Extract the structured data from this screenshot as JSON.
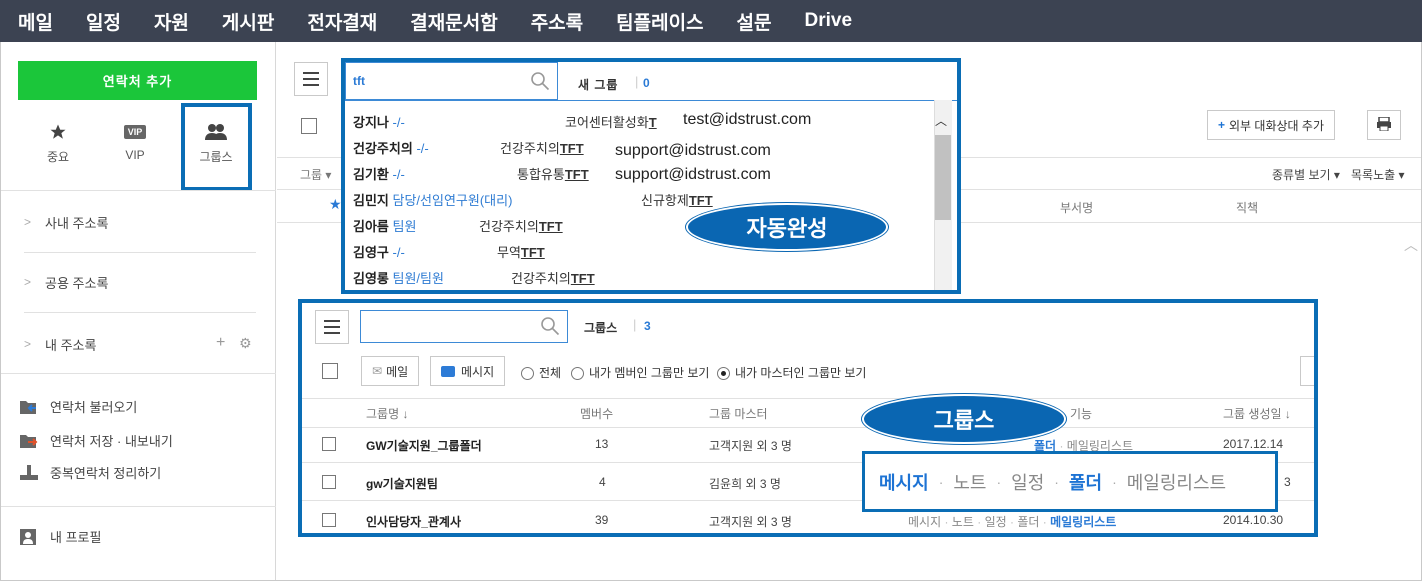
{
  "topnav": {
    "items": [
      "메일",
      "일정",
      "자원",
      "게시판",
      "전자결재",
      "결재문서함",
      "주소록",
      "팀플레이스",
      "설문",
      "Drive"
    ]
  },
  "sidebar": {
    "add_contact": "연락처 추가",
    "quick": [
      {
        "label": "중요",
        "icon": "star-icon"
      },
      {
        "label": "VIP",
        "badge": "VIP",
        "icon": "vip-icon"
      },
      {
        "label": "그룹스",
        "icon": "group-icon"
      }
    ],
    "sections": [
      "사내 주소록",
      "공용 주소록",
      "내 주소록"
    ],
    "tools": [
      "연락처 불러오기",
      "연락처 저장 · 내보내기",
      "중복연락처 정리하기"
    ],
    "profile": "내 프로필"
  },
  "main": {
    "add_external": "외부 대화상대 추가",
    "group_dropdown": "그룹",
    "view_by_type": "종류별 보기",
    "list_exposure": "목록노출",
    "col_dept": "부서명",
    "col_position": "직책"
  },
  "autocomplete": {
    "query": "tft",
    "new_group_label": "새 그룹",
    "new_group_count": "0",
    "callout": "자동완성",
    "rows": [
      {
        "name": "강지나",
        "pos": "-/-",
        "dept_pre": "코어센터활성화",
        "dept_u": "T",
        "email": "test@idstrust.com"
      },
      {
        "name": "건강주치의",
        "pos": "-/-",
        "dept_pre": "건강주치의",
        "dept_u": "TFT",
        "email": "support@idstrust.com"
      },
      {
        "name": "김기환",
        "pos": "-/-",
        "dept_pre": "통합유통",
        "dept_u": "TFT",
        "email": "support@idstrust.com"
      },
      {
        "name": "김민지",
        "pos": "담당/선임연구원(대리)",
        "dept_pre": "신규항제",
        "dept_u": "TFT",
        "email": ""
      },
      {
        "name": "김아름",
        "pos": "팀원",
        "dept_pre": "건강주치의",
        "dept_u": "TFT",
        "email": ""
      },
      {
        "name": "김영구",
        "pos": "-/-",
        "dept_pre": "무역",
        "dept_u": "TFT",
        "email": ""
      },
      {
        "name": "김영롱",
        "pos": "팀원/팀원",
        "dept_pre": "건강주치의",
        "dept_u": "TFT",
        "email": ""
      }
    ]
  },
  "groups": {
    "title": "그룹스",
    "count": "3",
    "callout": "그룹스",
    "btn_mail": "메일",
    "btn_message": "메시지",
    "filters": [
      "전체",
      "내가 멤버인 그룹만 보기",
      "내가 마스터인 그룹만 보기"
    ],
    "columns": {
      "name": "그룹명 ↓",
      "members": "멤버수",
      "master": "그룹 마스터",
      "features": "기능",
      "created": "그룹 생성일 ↓"
    },
    "rows": [
      {
        "name": "GW기술지원_그룹폴더",
        "members": "13",
        "master": "고객지원 외 3 명",
        "features": [
          "메시지",
          "노트",
          "일정",
          "폴더",
          "메일링리스트"
        ],
        "created": "2017.12.14"
      },
      {
        "name": "gw기술지원팀",
        "members": "4",
        "master": "김윤희 외 3 명",
        "features": [
          "메시지",
          "노트",
          "일정",
          "폴더",
          "메일링리스트"
        ],
        "created": "3"
      },
      {
        "name": "인사담당자_관계사",
        "members": "39",
        "master": "고객지원 외 3 명",
        "features": [
          "메시지",
          "노트",
          "일정",
          "폴더",
          "메일링리스트"
        ],
        "created": "2014.10.30"
      }
    ],
    "zoom_features": [
      "메시지",
      "노트",
      "일정",
      "폴더",
      "메일링리스트"
    ]
  }
}
